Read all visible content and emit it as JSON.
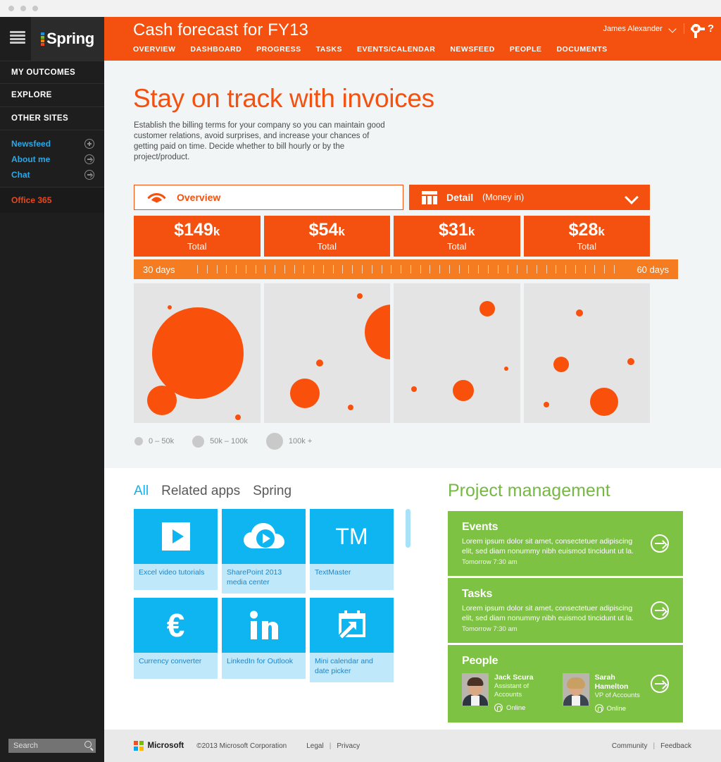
{
  "titlebar": {
    "dots": 3
  },
  "sidebar": {
    "logo_text": "Spring",
    "logo_colors": [
      "#1e90d8",
      "#7cbb28",
      "#f2820a",
      "#e8481c"
    ],
    "sections": [
      {
        "label": "MY OUTCOMES"
      },
      {
        "label": "EXPLORE"
      },
      {
        "label": "OTHER SITES"
      }
    ],
    "links": [
      {
        "label": "Newsfeed",
        "icon": "plus-circle-icon"
      },
      {
        "label": "About me",
        "icon": "arrow-circle-icon"
      },
      {
        "label": "Chat",
        "icon": "arrow-circle-icon"
      }
    ],
    "office": "Office 365",
    "search_placeholder": "Search"
  },
  "header": {
    "title": "Cash forecast for FY13",
    "nav": [
      "OVERVIEW",
      "DASHBOARD",
      "PROGRESS",
      "TASKS",
      "EVENTS/CALENDAR",
      "NEWSFEED",
      "PEOPLE",
      "DOCUMENTS"
    ],
    "user": "James Alexander",
    "accent": "#f4500f"
  },
  "hero": {
    "title": "Stay on track with invoices",
    "body": "Establish the billing terms for your company so you can maintain good customer relations, avoid surprises, and increase your chances of getting paid on time. Decide whether to bill hourly or by the project/product."
  },
  "views": {
    "overview_label": "Overview",
    "detail_label": "Detail",
    "detail_sub": "(Money in)"
  },
  "totals": [
    {
      "value": "$149",
      "unit": "k",
      "label": "Total"
    },
    {
      "value": "$54",
      "unit": "k",
      "label": "Total"
    },
    {
      "value": "$31",
      "unit": "k",
      "label": "Total"
    },
    {
      "value": "$28",
      "unit": "k",
      "label": "Total"
    }
  ],
  "slider": {
    "left": "30 days",
    "right": "60 days",
    "tick_count": 44
  },
  "legend": [
    {
      "label": "0 – 50k",
      "size": 12
    },
    {
      "label": "50k – 100k",
      "size": 17
    },
    {
      "label": "100k +",
      "size": 24
    }
  ],
  "chart_data": {
    "type": "scatter",
    "title": "Cash forecast bubbles",
    "xlabel": "",
    "ylabel": "",
    "bubble_color": "#f9510c",
    "panel_bg": "#e4e4e4",
    "size_legend": [
      "0 – 50k",
      "50k – 100k",
      "100k +"
    ],
    "panels": [
      {
        "total": "$149k",
        "bubbles": [
          {
            "x": 27,
            "y": 17,
            "r": 3
          },
          {
            "x": 48,
            "y": 50,
            "r": 65
          },
          {
            "x": 21,
            "y": 84,
            "r": 21
          },
          {
            "x": 78,
            "y": 96,
            "r": 4
          }
        ]
      },
      {
        "total": "$54k",
        "bubbles": [
          {
            "x": 72,
            "y": 9,
            "r": 4
          },
          {
            "x": 96,
            "y": 35,
            "r": 39
          },
          {
            "x": 42,
            "y": 57,
            "r": 5
          },
          {
            "x": 31,
            "y": 79,
            "r": 21
          },
          {
            "x": 65,
            "y": 89,
            "r": 4
          }
        ]
      },
      {
        "total": "$31k",
        "bubbles": [
          {
            "x": 70,
            "y": 18,
            "r": 11
          },
          {
            "x": 84,
            "y": 61,
            "r": 3
          },
          {
            "x": 15,
            "y": 76,
            "r": 4
          },
          {
            "x": 52,
            "y": 77,
            "r": 15
          }
        ]
      },
      {
        "total": "$28k",
        "bubbles": [
          {
            "x": 42,
            "y": 21,
            "r": 5
          },
          {
            "x": 28,
            "y": 58,
            "r": 11
          },
          {
            "x": 80,
            "y": 56,
            "r": 5
          },
          {
            "x": 17,
            "y": 87,
            "r": 4
          },
          {
            "x": 60,
            "y": 85,
            "r": 20
          }
        ]
      }
    ]
  },
  "apps": {
    "tabs": [
      {
        "label": "All",
        "active": true
      },
      {
        "label": "Related apps",
        "active": false
      },
      {
        "label": "Spring",
        "active": false
      }
    ],
    "tiles": [
      {
        "name": "Excel video tutorials",
        "icon": "play-button-icon"
      },
      {
        "name": "SharePoint 2013 media center",
        "icon": "cloud-play-icon"
      },
      {
        "name": "TextMaster",
        "icon": "tm-monogram-icon"
      },
      {
        "name": "Currency converter",
        "icon": "euro-icon"
      },
      {
        "name": "LinkedIn for Outlook",
        "icon": "linkedin-icon"
      },
      {
        "name": "Mini calendar and date picker",
        "icon": "calendar-arrow-icon"
      }
    ]
  },
  "project_management": {
    "title": "Project management",
    "accent": "#7dc242",
    "cards": [
      {
        "title": "Events",
        "desc": "Lorem ipsum dolor sit amet, consectetuer adipiscing elit, sed diam nonummy nibh euismod tincidunt ut la.",
        "when": "Tomorrow 7:30 am"
      },
      {
        "title": "Tasks",
        "desc": "Lorem ipsum dolor sit amet, consectetuer adipiscing elit, sed diam nonummy nibh euismod tincidunt ut la.",
        "when": "Tomorrow 7:30 am"
      }
    ],
    "people_card": {
      "title": "People",
      "people": [
        {
          "name": "Jack Scura",
          "role": "Assistant of Accounts",
          "status": "Online",
          "hair": "#4a3326",
          "body": "#2d3640"
        },
        {
          "name": "Sarah Hamelton",
          "role": "VP of Accounts",
          "status": "Online",
          "hair": "#c9a063",
          "body": "#3a4550"
        }
      ]
    }
  },
  "footer": {
    "brand": "Microsoft",
    "copyright": "©2013 Microsoft Corporation",
    "links": [
      "Legal",
      "Privacy"
    ],
    "right_links": [
      "Community",
      "Feedback"
    ],
    "sep": "|"
  }
}
